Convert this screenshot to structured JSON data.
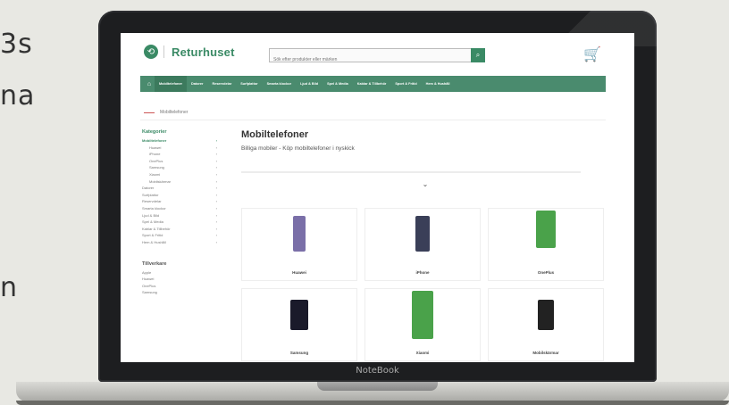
{
  "background_text": [
    "3s",
    "na",
    "n"
  ],
  "laptop_label": "NoteBook",
  "site": {
    "logo_text": "Returhuset",
    "search_placeholder": "Sök efter produkter eller märken",
    "nav": [
      "Mobiltelefoner",
      "Datorer",
      "Reservdelar",
      "Surfplattor",
      "Smarta klockor",
      "Ljud & Bild",
      "Spel & Media",
      "Kablar & Tillbehör",
      "Sport & Fritid",
      "Hem & Hushåll"
    ],
    "breadcrumb": "Mobiltelefoner",
    "sidebar": {
      "heading": "Kategorier",
      "items": [
        {
          "label": "Mobiltelefoner",
          "level": 0,
          "active": true
        },
        {
          "label": "Huawei",
          "level": 1
        },
        {
          "label": "iPhone",
          "level": 1
        },
        {
          "label": "OnePlus",
          "level": 1
        },
        {
          "label": "Samsung",
          "level": 1
        },
        {
          "label": "Xiaomi",
          "level": 1
        },
        {
          "label": "Mobilskärmar",
          "level": 1
        },
        {
          "label": "Datorer",
          "level": 0
        },
        {
          "label": "Surfplattor",
          "level": 0
        },
        {
          "label": "Reservdelar",
          "level": 0
        },
        {
          "label": "Smarta klockor",
          "level": 0
        },
        {
          "label": "Ljud & Bild",
          "level": 0
        },
        {
          "label": "Spel & Media",
          "level": 0
        },
        {
          "label": "Kablar & Tillbehör",
          "level": 0
        },
        {
          "label": "Sport & Fritid",
          "level": 0
        },
        {
          "label": "Hem & Hushåll",
          "level": 0
        }
      ],
      "filter_heading": "Tillverkare",
      "filter_items": [
        "Apple",
        "Huawei",
        "OnePlus",
        "Samsung"
      ]
    },
    "main": {
      "title": "Mobiltelefoner",
      "subtitle": "Billiga mobiler - Köp mobiltelefoner i nyskick",
      "products": [
        {
          "label": "Huawei",
          "color": "#7a6fa8"
        },
        {
          "label": "iPhone",
          "color": "#3a3f58"
        },
        {
          "label": "OnePlus",
          "color": "#4aa24a"
        },
        {
          "label": "Samsung",
          "color": "#1a1a2a"
        },
        {
          "label": "Xiaomi",
          "color": "#4aa24a"
        },
        {
          "label": "Mobilskärmar",
          "color": "#222"
        }
      ]
    },
    "colors": {
      "brand": "#3a8a65",
      "nav": "#4a8b6e"
    }
  }
}
